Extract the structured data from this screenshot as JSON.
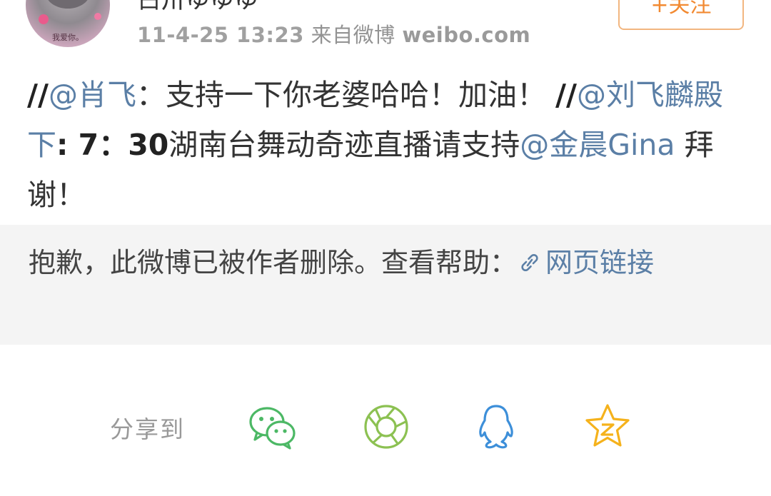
{
  "header": {
    "username": "占卅ゆゆゆ",
    "avatar_caption": "我爱你。",
    "timestamp": "11-4-25 13:23",
    "source_prefix": "来自微博",
    "source_site": "weibo.com",
    "follow_label": "+关注"
  },
  "post": {
    "segments": [
      {
        "text": "//",
        "kind": "slash"
      },
      {
        "text": "@肖飞",
        "kind": "mention"
      },
      {
        "text": "：支持一下你老婆哈哈！加油！ ",
        "kind": "plain"
      },
      {
        "text": "//",
        "kind": "slash"
      },
      {
        "text": "@刘飞麟殿下",
        "kind": "mention"
      },
      {
        "text": ": 7：30",
        "kind": "bold"
      },
      {
        "text": "湖南台舞动奇迹直播请支持",
        "kind": "plain"
      },
      {
        "text": "@金晨Gina",
        "kind": "mention"
      },
      {
        "text": " 拜谢！",
        "kind": "plain"
      }
    ]
  },
  "deleted_notice": {
    "message": "抱歉，此微博已被作者删除。查看帮助：",
    "link_label": "网页链接",
    "link_icon": "link-icon"
  },
  "share": {
    "label": "分享到",
    "targets": [
      {
        "name": "wechat",
        "icon": "wechat-icon",
        "color": "#4cb865"
      },
      {
        "name": "moments",
        "icon": "moments-icon",
        "color": "#8cc152"
      },
      {
        "name": "qq",
        "icon": "qq-icon",
        "color": "#3d8fd9"
      },
      {
        "name": "qzone",
        "icon": "qzone-icon",
        "color": "#f5b21c"
      }
    ]
  },
  "colors": {
    "mention": "#5b7fa6",
    "follow_accent": "#f28a32",
    "deleted_bg": "#f4f4f4"
  }
}
